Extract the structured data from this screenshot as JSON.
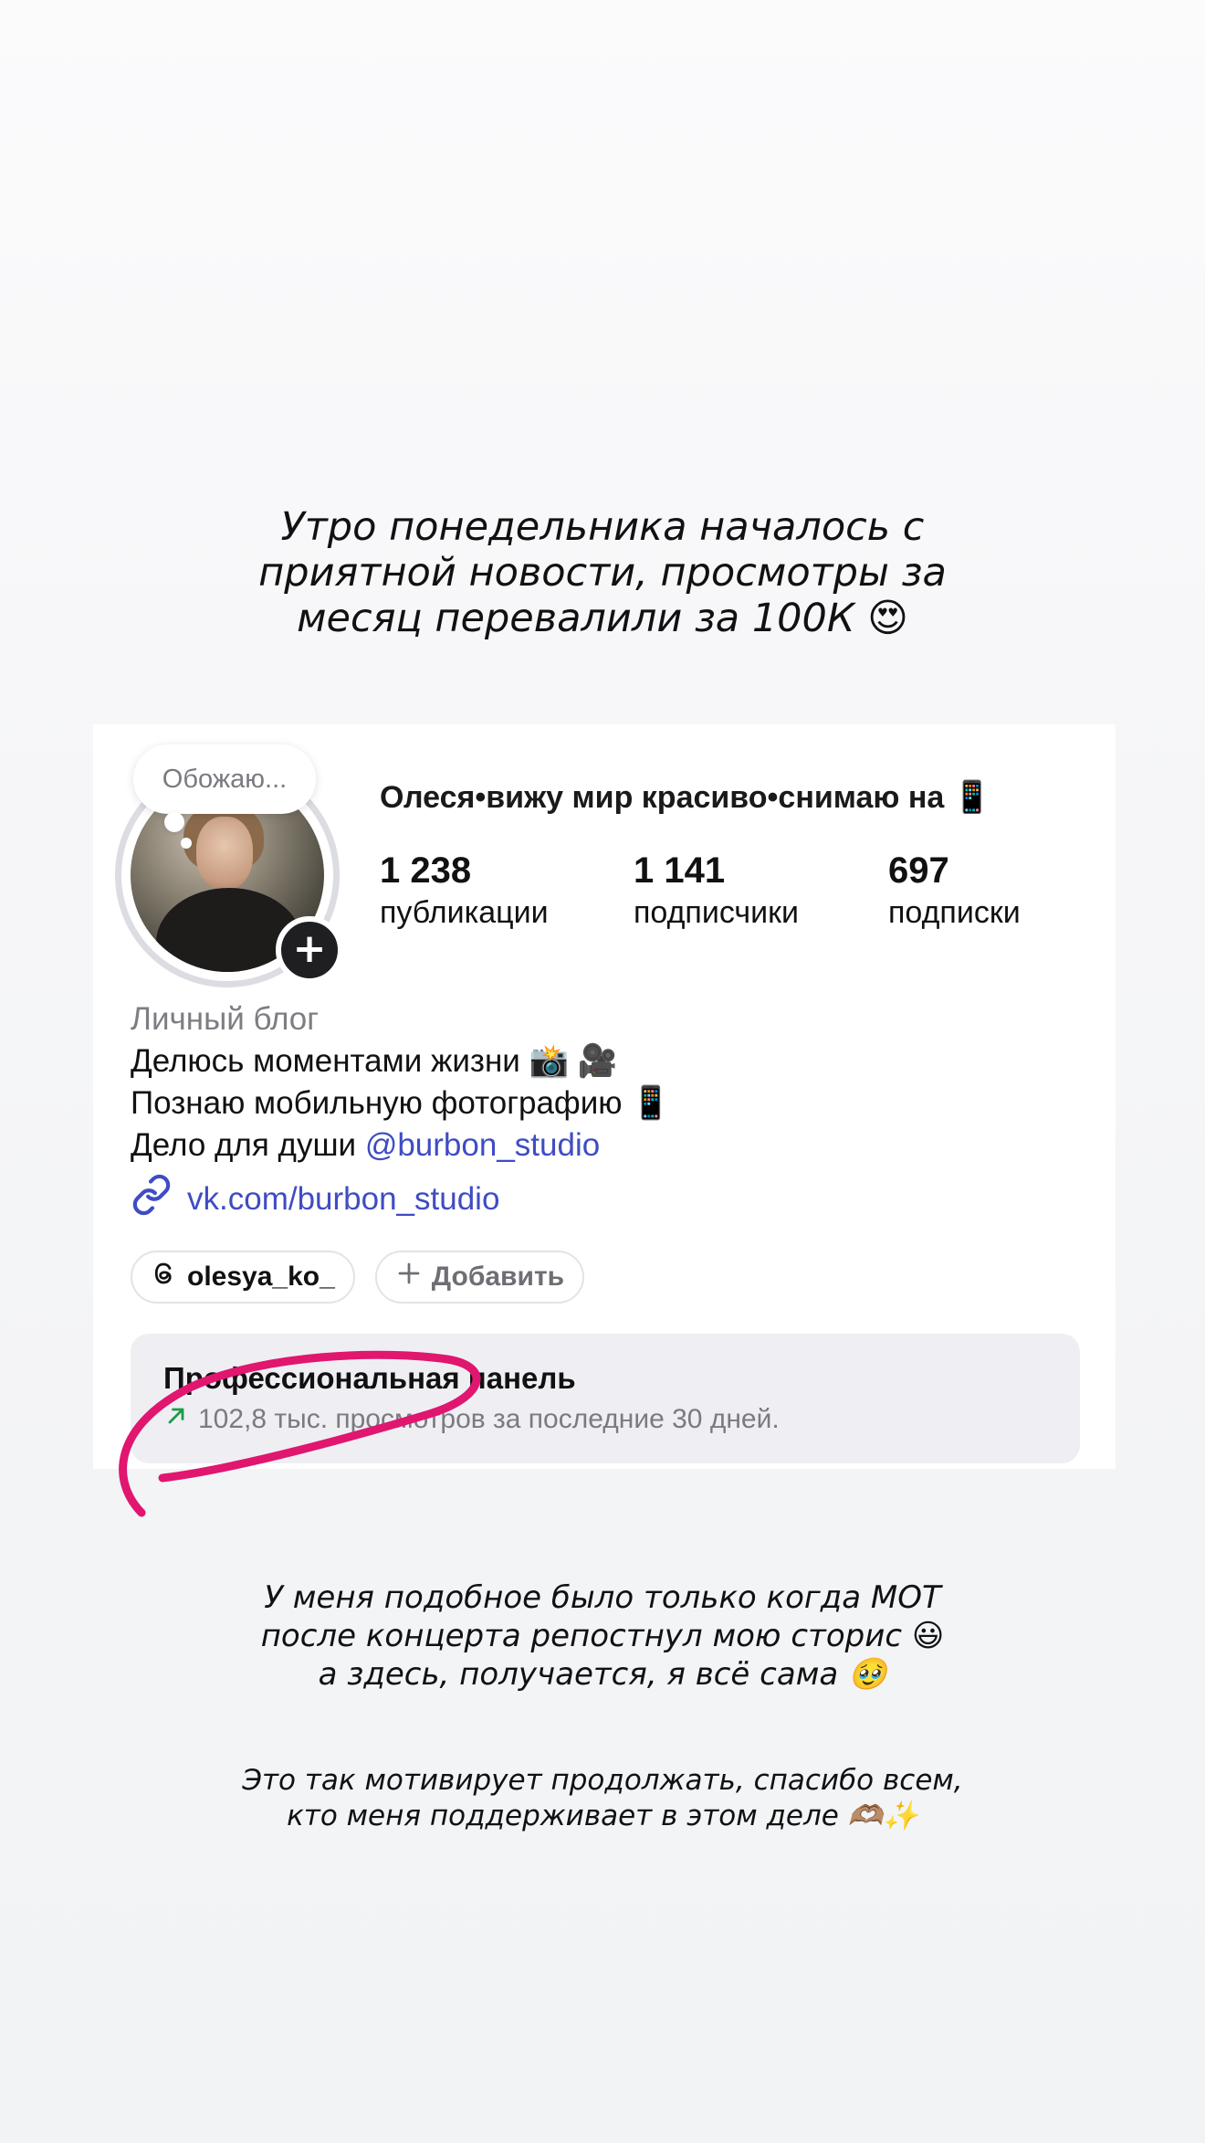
{
  "caption_top": {
    "lines": [
      "Утро понедельника началось с",
      "приятной новости, просмотры за",
      "месяц перевалили за 100К 😍"
    ]
  },
  "profile": {
    "note_bubble": "Обожаю...",
    "name": "Олеся•вижу мир красиво•снимаю на 📱",
    "stats": [
      {
        "value": "1 238",
        "label": "публикации"
      },
      {
        "value": "1 141",
        "label": "подписчики"
      },
      {
        "value": "697",
        "label": "подписки"
      }
    ],
    "category": "Личный блог",
    "bio_line1": "Делюсь моментами жизни 📸 🎥",
    "bio_line2": "Познаю мобильную фотографию 📱",
    "bio_line3_text": "Дело для души ",
    "bio_line3_mention": "@burbon_studio",
    "link": "vk.com/burbon_studio",
    "threads_handle": "olesya_ko_",
    "add_label": "Добавить"
  },
  "pro_panel": {
    "title": "Профессиональная панель",
    "subtitle": "102,8 тыс. просмотров за последние 30 дней."
  },
  "caption_middle": {
    "lines": [
      "У меня подобное было только когда МОТ",
      "после концерта репостнул мою сторис 😃",
      "а здесь, получается, я всё сама 🥹"
    ]
  },
  "caption_bottom": {
    "lines": [
      "Это так мотивирует продолжать, спасибо всем,",
      "кто меня поддерживает в этом деле 🫶🏽✨"
    ]
  },
  "colors": {
    "accent_link": "#3f4cc4",
    "annotation": "#e0166f",
    "trend_arrow": "#1f9a4a"
  },
  "icons": [
    "plus-icon",
    "link-icon",
    "threads-icon",
    "add-icon",
    "trend-up-icon"
  ]
}
